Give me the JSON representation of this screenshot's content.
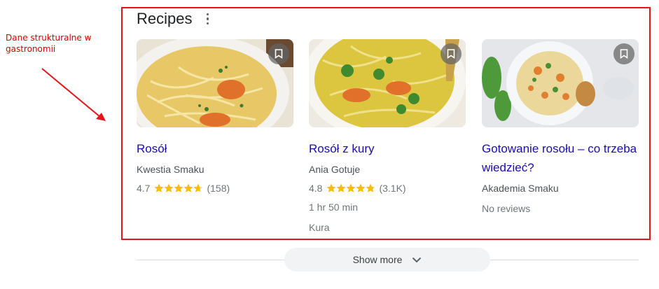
{
  "annotation": {
    "text": "Dane strukturalne w gastronomii",
    "color": "#d40000"
  },
  "section": {
    "title": "Recipes"
  },
  "cards": [
    {
      "title": "Rosół",
      "source": "Kwestia Smaku",
      "rating": "4.7",
      "rating_value": 4.7,
      "reviews": "(158)"
    },
    {
      "title": "Rosół z kury",
      "source": "Ania Gotuje",
      "rating": "4.8",
      "rating_value": 4.8,
      "reviews": "(3.1K)",
      "time": "1 hr 50 min",
      "ingredient": "Kura"
    },
    {
      "title": "Gotowanie rosołu – co trzeba wiedzieć?",
      "source": "Akademia Smaku",
      "no_reviews": "No reviews"
    }
  ],
  "show_more": {
    "label": "Show more"
  },
  "colors": {
    "link": "#1a0dab",
    "star": "#fbbc04",
    "highlight": "#e3161b"
  }
}
